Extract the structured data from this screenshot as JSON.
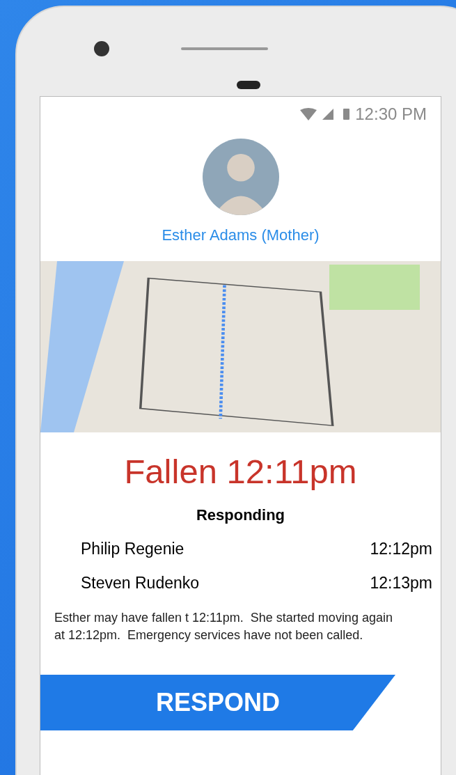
{
  "status_bar": {
    "time": "12:30 PM"
  },
  "contact": {
    "name": "Esther Adams (Mother)"
  },
  "alert": {
    "title": "Fallen 12:11pm"
  },
  "responders": {
    "heading": "Responding",
    "rows": [
      {
        "name": "Philip Regenie",
        "time": "12:12pm"
      },
      {
        "name": "Steven Rudenko",
        "time": "12:13pm"
      }
    ]
  },
  "message": "Esther may have fallen t 12:11pm.  She started moving again at 12:12pm.  Emergency services have not been called.",
  "action_button": "RESPOND"
}
